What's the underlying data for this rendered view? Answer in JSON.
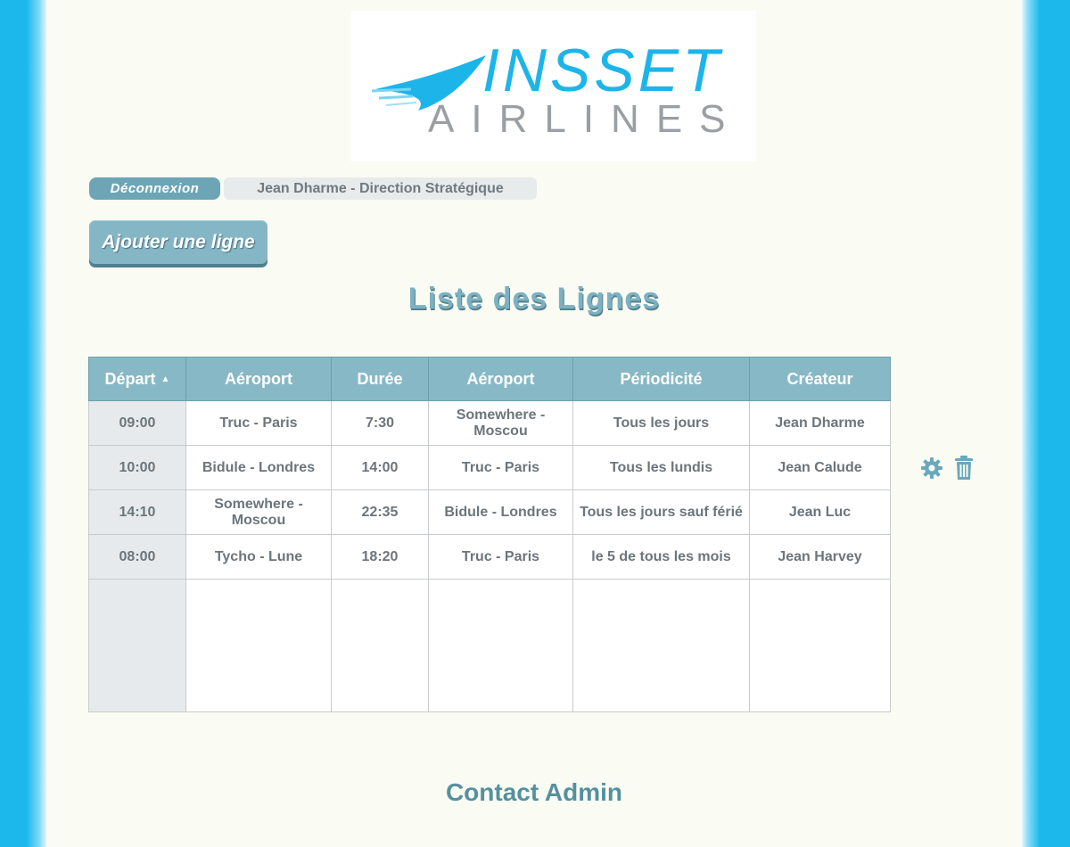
{
  "brand": {
    "logo_top": "INSSET",
    "logo_bottom": "AIRLINES"
  },
  "header": {
    "logout_label": "Déconnexion",
    "user_label": "Jean Dharme - Direction Stratégique"
  },
  "toolbar": {
    "add_label": "Ajouter une ligne"
  },
  "page_title": "Liste des Lignes",
  "table": {
    "sort_indicator": "▲",
    "columns": [
      "Départ",
      "Aéroport",
      "Durée",
      "Aéroport",
      "Périodicité",
      "Créateur"
    ],
    "rows": [
      [
        "09:00",
        "Truc - Paris",
        "7:30",
        "Somewhere - Moscou",
        "Tous les jours",
        "Jean Dharme"
      ],
      [
        "10:00",
        "Bidule - Londres",
        "14:00",
        "Truc - Paris",
        "Tous les lundis",
        "Jean Calude"
      ],
      [
        "14:10",
        "Somewhere - Moscou",
        "22:35",
        "Bidule - Londres",
        "Tous les jours sauf férié",
        "Jean Luc"
      ],
      [
        "08:00",
        "Tycho - Lune",
        "18:20",
        "Truc - Paris",
        "le 5 de tous les mois",
        "Jean Harvey"
      ]
    ]
  },
  "row_actions": {
    "icons": [
      "gear-icon",
      "trash-icon"
    ],
    "color": "#6aa8bb"
  },
  "footer": {
    "contact_label": "Contact Admin"
  },
  "colors": {
    "side_blue": "#1cb8ec",
    "page_bg": "#fafcf3",
    "header_teal": "#87b8c5",
    "text_teal": "#55909f"
  }
}
